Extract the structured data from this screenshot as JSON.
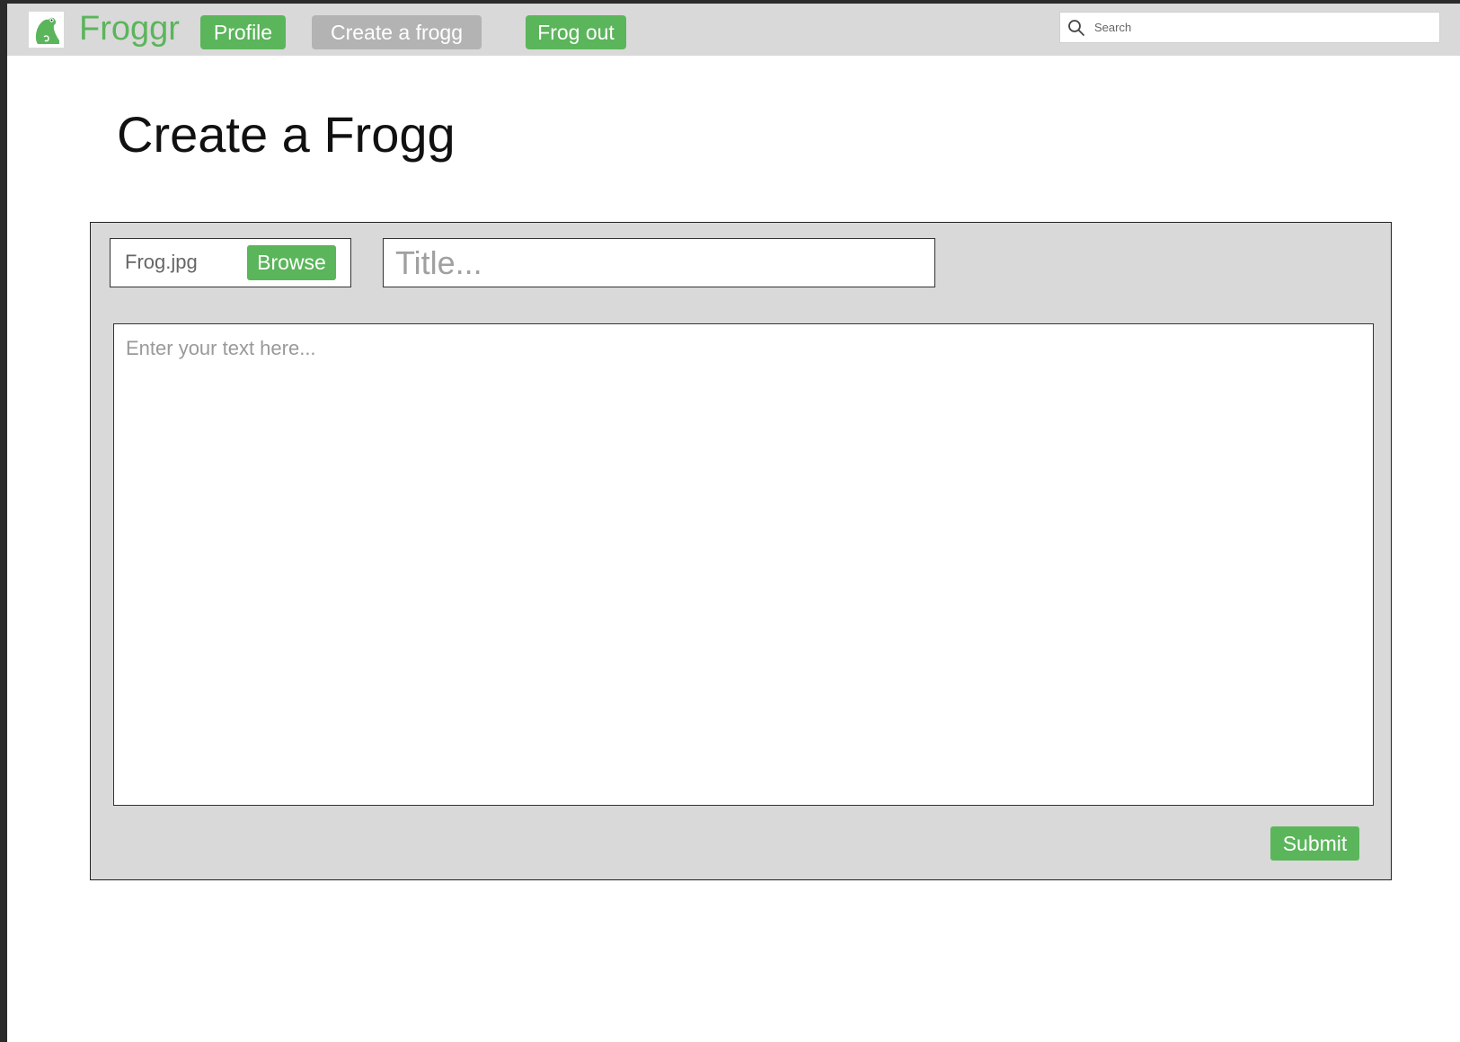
{
  "brand": {
    "name": "Froggr",
    "logo_icon": "frog-icon",
    "brand_color": "#5bb55b"
  },
  "nav": {
    "profile_label": "Profile",
    "create_label": "Create a frogg",
    "logout_label": "Frog out",
    "active_item": "Create a frogg"
  },
  "search": {
    "placeholder": "Search",
    "value": "",
    "icon": "search-icon"
  },
  "page": {
    "title": "Create a Frogg"
  },
  "form": {
    "file_name": "Frog.jpg",
    "browse_label": "Browse",
    "title_placeholder": "Title...",
    "title_value": "",
    "body_placeholder": "Enter your text here...",
    "body_value": "",
    "submit_label": "Submit"
  },
  "colors": {
    "accent": "#5bb55b",
    "nav_background": "#d9d9d9",
    "inactive_button": "#b3b3b3",
    "panel_background": "#d9d9d9"
  }
}
